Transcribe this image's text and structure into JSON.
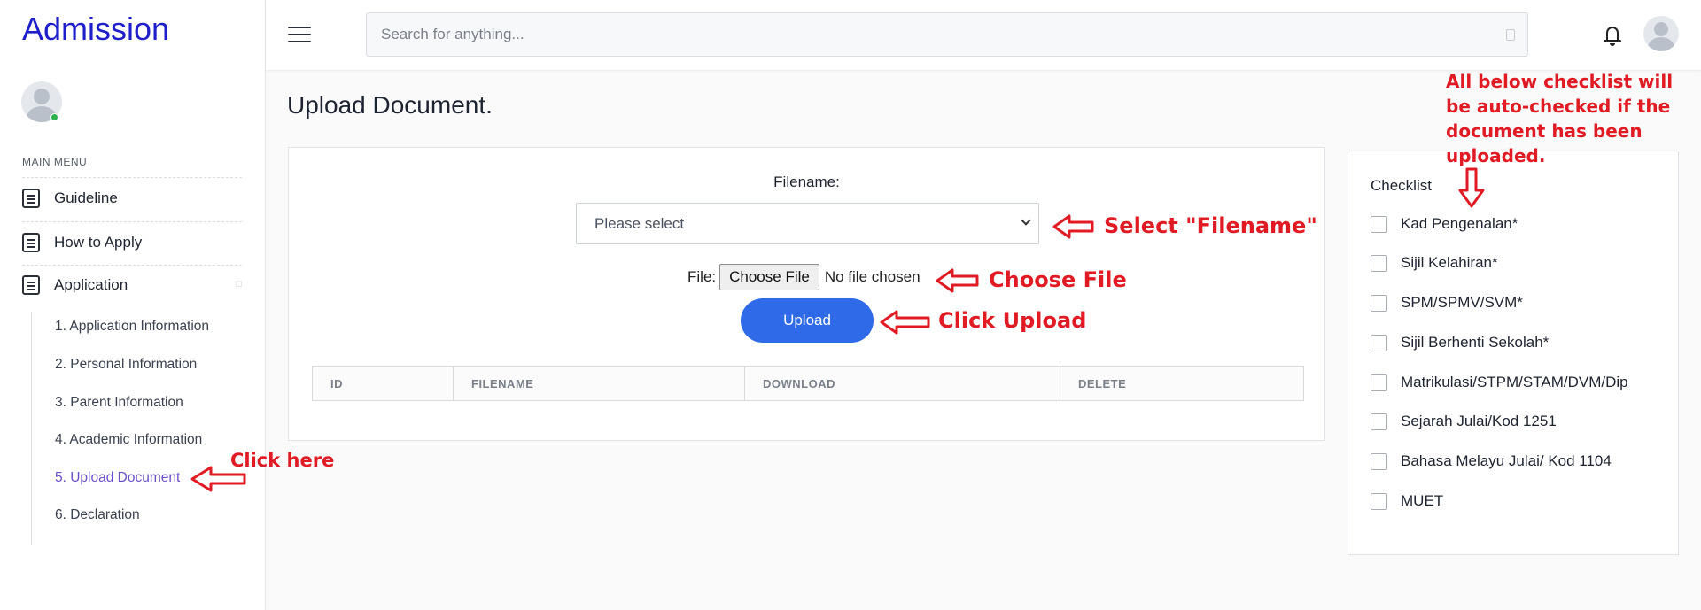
{
  "sidebar": {
    "brand": "Admission",
    "menu_title": "MAIN MENU",
    "items": [
      {
        "label": "Guideline"
      },
      {
        "label": "How to Apply"
      },
      {
        "label": "Application"
      }
    ],
    "application_sub": [
      {
        "label": "1. Application Information"
      },
      {
        "label": "2. Personal Information"
      },
      {
        "label": "3. Parent Information"
      },
      {
        "label": "4. Academic Information"
      },
      {
        "label": "5. Upload Document",
        "active": true
      },
      {
        "label": "6. Declaration"
      }
    ]
  },
  "topbar": {
    "search_placeholder": "Search for anything..."
  },
  "page": {
    "title": "Upload Document."
  },
  "upload_form": {
    "filename_label": "Filename:",
    "select_value": "Please select",
    "file_label": "File:",
    "choose_file_label": "Choose File",
    "no_file_text": "No file chosen",
    "upload_label": "Upload",
    "table_headers": [
      "ID",
      "FILENAME",
      "DOWNLOAD",
      "DELETE"
    ]
  },
  "checklist": {
    "title": "Checklist",
    "items": [
      "Kad Pengenalan*",
      "Sijil Kelahiran*",
      "SPM/SPMV/SVM*",
      "Sijil Berhenti Sekolah*",
      "Matrikulasi/STPM/STAM/DVM/Dip",
      "Sejarah Julai/Kod 1251",
      "Bahasa Melayu Julai/ Kod 1104",
      "MUET"
    ]
  },
  "annotations": {
    "select_filename": "Select \"Filename\"",
    "choose_file": "Choose File",
    "click_upload": "Click Upload",
    "click_here": "Click here",
    "checklist_note_lines": [
      "All below checklist will",
      "be auto-checked if the",
      "document has been",
      "uploaded."
    ]
  },
  "colors": {
    "brand": "#1f1fc9",
    "primary_button": "#2f6ae8",
    "annotation": "#e01b24",
    "active_submenu": "#6a50c8",
    "online": "#2bb24c"
  }
}
